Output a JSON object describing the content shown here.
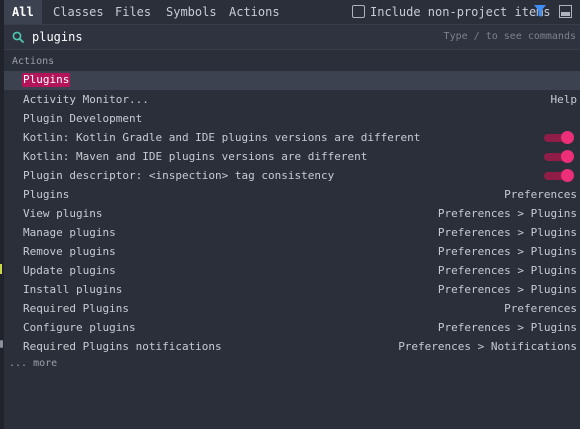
{
  "tabs": [
    {
      "label": "All",
      "selected": true
    },
    {
      "label": "Classes",
      "selected": false
    },
    {
      "label": "Files",
      "selected": false
    },
    {
      "label": "Symbols",
      "selected": false
    },
    {
      "label": "Actions",
      "selected": false
    }
  ],
  "include_non_project": {
    "label": "Include non-project items",
    "checked": false
  },
  "toolbar_icons": [
    "filter-icon",
    "preview-icon"
  ],
  "search": {
    "value": "plugins",
    "hint": "Type / to see commands"
  },
  "section": {
    "header": "Actions"
  },
  "results": [
    {
      "name": "Plugins",
      "location": "",
      "toggle": false,
      "selected": true,
      "highlighted": true
    },
    {
      "name": "Activity Monitor...",
      "location": "Help",
      "toggle": false
    },
    {
      "name": "Plugin Development",
      "location": "",
      "toggle": false
    },
    {
      "name": "Kotlin: Kotlin Gradle and IDE plugins versions are different",
      "location": "",
      "toggle": true
    },
    {
      "name": "Kotlin: Maven and IDE plugins versions are different",
      "location": "",
      "toggle": true
    },
    {
      "name": "Plugin descriptor: <inspection> tag consistency",
      "location": "",
      "toggle": true
    },
    {
      "name": "Plugins",
      "location": "Preferences",
      "toggle": false
    },
    {
      "name": "View plugins",
      "location": "Preferences > Plugins",
      "toggle": false
    },
    {
      "name": "Manage plugins",
      "location": "Preferences > Plugins",
      "toggle": false
    },
    {
      "name": "Remove plugins",
      "location": "Preferences > Plugins",
      "toggle": false
    },
    {
      "name": "Update plugins",
      "location": "Preferences > Plugins",
      "toggle": false
    },
    {
      "name": "Install plugins",
      "location": "Preferences > Plugins",
      "toggle": false
    },
    {
      "name": "Required Plugins",
      "location": "Preferences",
      "toggle": false
    },
    {
      "name": "Configure plugins",
      "location": "Preferences > Plugins",
      "toggle": false
    },
    {
      "name": "Required Plugins notifications",
      "location": "Preferences > Notifications",
      "toggle": false
    }
  ],
  "more_label": "... more",
  "colors": {
    "background": "#2b2f3a",
    "selection": "#3d4250",
    "match_highlight": "#b4145a",
    "toggle_on": "#ec2f78",
    "filter_icon": "#3e8ef7"
  }
}
